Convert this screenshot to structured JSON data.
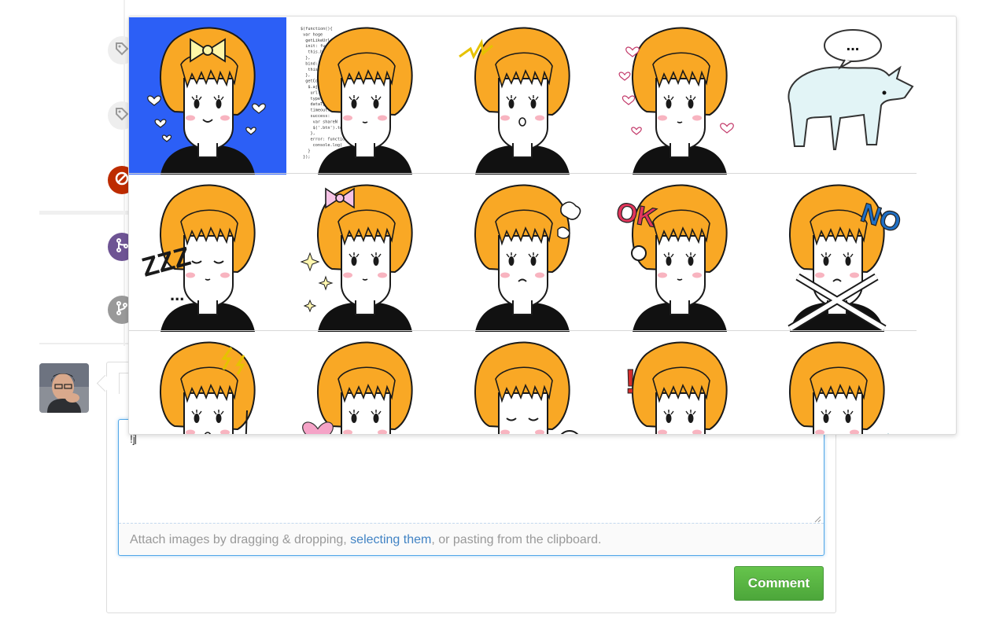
{
  "timeline": {
    "events": [
      {
        "icon": "tag-icon",
        "color": "#eeeeee",
        "icon_color": "#999999"
      },
      {
        "icon": "tag-icon",
        "color": "#eeeeee",
        "icon_color": "#999999"
      },
      {
        "icon": "closed-icon",
        "color": "#bd2c00",
        "icon_color": "#ffffff"
      },
      {
        "icon": "merge-icon",
        "color": "#6e5494",
        "icon_color": "#ffffff"
      },
      {
        "icon": "branch-icon",
        "color": "#999999",
        "icon_color": "#ffffff"
      }
    ]
  },
  "comment_form": {
    "textarea_value": "!j",
    "attach_hint_before": "Attach images by dragging & dropping, ",
    "attach_hint_link": "selecting them",
    "attach_hint_after": ", or pasting from the clipboard.",
    "submit_label": "Comment"
  },
  "sticker_picker": {
    "selected_index": 0,
    "accent_color": "#2c5ff6",
    "rows": [
      [
        {
          "name": "bow-hearts",
          "accessory": "bow",
          "expr": "smile",
          "text": ""
        },
        {
          "name": "code",
          "accessory": "code",
          "expr": "neutral",
          "text": ""
        },
        {
          "name": "surprised-sparkle",
          "accessory": "spark",
          "expr": "open",
          "text": ""
        },
        {
          "name": "hearts",
          "accessory": "hearts",
          "expr": "neutral",
          "text": ""
        },
        {
          "name": "rhino",
          "accessory": "rhino",
          "expr": "",
          "text": "..."
        }
      ],
      [
        {
          "name": "sleepy",
          "accessory": "zzz",
          "expr": "closed",
          "text": "ZZZ..."
        },
        {
          "name": "sparkle-pray",
          "accessory": "pinkbow",
          "expr": "neutral",
          "text": ""
        },
        {
          "name": "angry",
          "accessory": "puff",
          "expr": "frown",
          "text": ""
        },
        {
          "name": "ok",
          "accessory": "ok",
          "expr": "neutral",
          "text": "OK"
        },
        {
          "name": "no",
          "accessory": "no",
          "expr": "frown",
          "text": "NO"
        }
      ],
      [
        {
          "name": "shock-lightning",
          "accessory": "bolt",
          "expr": "open",
          "text": ""
        },
        {
          "name": "pink-heart",
          "accessory": "bigheart",
          "expr": "neutral",
          "text": ""
        },
        {
          "name": "scribble",
          "accessory": "scribble",
          "expr": "closed",
          "text": ""
        },
        {
          "name": "reading-exclaim",
          "accessory": "book",
          "expr": "neutral",
          "text": "!"
        },
        {
          "name": "sweat-drops",
          "accessory": "drops",
          "expr": "neutral",
          "text": ""
        }
      ]
    ],
    "code_lines": [
      "$(function(){",
      " var hoge",
      "  getLikeUrl: \"http://",
      "  init: function() {",
      "   this.bind();",
      "  },",
      "  bind: function",
      "   this.getCoun",
      "  },",
      "  getCount: fu",
      "   $.ajax({",
      "    url: this.",
      "    type: 'GE",
      "    dataType",
      "    timeout:",
      "    success:",
      "     var shareN",
      "     $('.btn').text(sha",
      "    },",
      "    error: function(",
      "     console.log(",
      "   }",
      " });"
    ]
  }
}
